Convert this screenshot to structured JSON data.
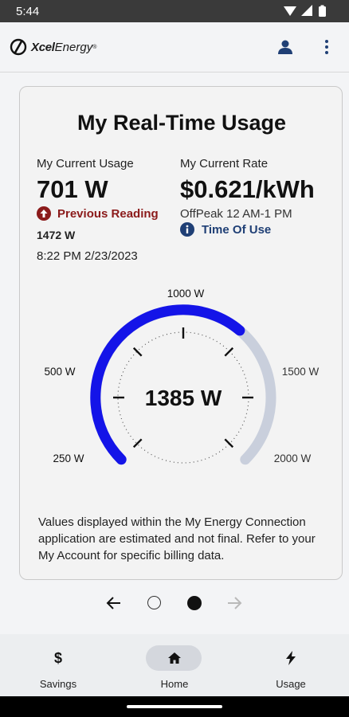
{
  "status_bar": {
    "time": "5:44"
  },
  "header": {
    "brand_part1": "Xcel",
    "brand_part2": "Energy",
    "brand_mark": "®"
  },
  "card": {
    "title": "My Real-Time Usage",
    "current_usage_label": "My Current Usage",
    "current_usage_value": "701 W",
    "previous_reading_label": "Previous Reading",
    "previous_reading_value": "1472 W",
    "reading_timestamp": "8:22 PM 2/23/2023",
    "current_rate_label": "My Current Rate",
    "current_rate_value": "$0.621/kWh",
    "rate_period": "OffPeak 12 AM-1 PM",
    "time_of_use_label": "Time Of Use",
    "gauge": {
      "value_text": "1385 W",
      "value": 1385,
      "scale_labels": [
        "250 W",
        "500 W",
        "1000 W",
        "1500 W",
        "2000 W"
      ],
      "fill_color": "#1414e8",
      "track_color": "#c9cfdc"
    },
    "disclaimer": "Values displayed within the My Energy Connection application are estimated and not final. Refer to your My Account for specific billing data."
  },
  "pager": {
    "pages": 2,
    "current": 2
  },
  "bottom_nav": {
    "items": [
      {
        "label": "Savings",
        "icon": "dollar-icon"
      },
      {
        "label": "Home",
        "icon": "home-icon"
      },
      {
        "label": "Usage",
        "icon": "lightning-icon"
      }
    ],
    "active": "Home"
  },
  "colors": {
    "prev_reading": "#8b1a1a",
    "time_of_use": "#1f3f75",
    "user_icon": "#1f3f75"
  }
}
